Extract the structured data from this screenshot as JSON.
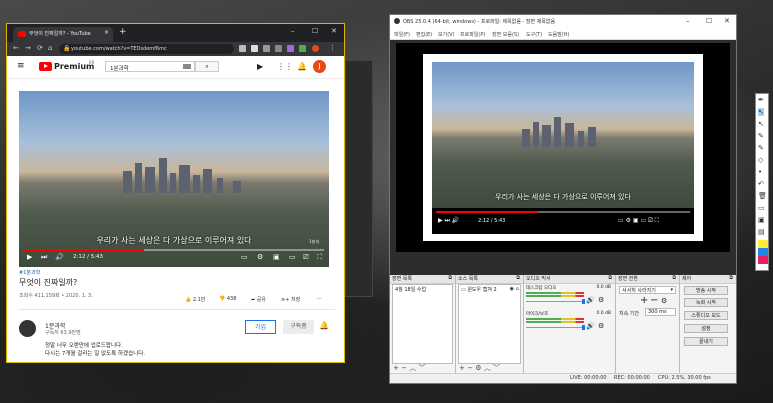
{
  "chrome": {
    "tab_title": "무엇이 진짜일까? - YouTube",
    "url": "youtube.com/watch?v=TEDsdemf6mc",
    "nav": [
      "←",
      "→",
      "⟳",
      "⌂"
    ]
  },
  "youtube": {
    "brand": "Premium",
    "brand_sup": "KR",
    "search_value": "1분과학",
    "avatar_letter": "J",
    "subtitle": "우리가 사는 세상은 다 가상으로 이루어져 있다",
    "time": "2:12 / 5:43",
    "watermark": "1분과",
    "hashtag": "#1분과학",
    "title": "무엇이 진짜일까?",
    "views": "조회수 411,159회 • 2020. 1. 3.",
    "likes": "2.1만",
    "dislikes": "438",
    "share": "공유",
    "save": "저장",
    "more": "⋯",
    "channel": "1분과학",
    "subscribers": "구독자 63.9만명",
    "join": "가입",
    "subscribed": "구독중",
    "desc_line1": "정말 너무 오랜만에 업로드합니다.",
    "desc_line2": "다시는 7개월 걸리는 일 없도록 하겠습니다."
  },
  "obs": {
    "title": "OBS 25.0.4 (64-bit, windows) - 프로파일: 제목없음 - 장면 제목없음",
    "menu": [
      "파일(F)",
      "편집(E)",
      "보기(V)",
      "프로파일(P)",
      "장면 모음(S)",
      "도구(T)",
      "도움말(H)"
    ],
    "preview_subtitle": "우리가 사는 세상은 다 가상으로 이루어져 있다",
    "preview_time": "2:12 / 5:43",
    "docks": {
      "scenes": "장면 목록",
      "sources": "소스 목록",
      "mixer": "오디오 믹서",
      "transitions": "장면 전환",
      "controls": "제어"
    },
    "scene_item": "4월 18일 수업",
    "source_item": "윈도우 캡쳐 2",
    "mixer_rows": [
      {
        "name": "데스크탑 오디오",
        "db": "0.0 dB"
      },
      {
        "name": "마이크/보조",
        "db": "0.0 dB"
      }
    ],
    "transition": "서서히 사라지기",
    "duration_label": "지속 기간",
    "duration_value": "300 ms",
    "controls_buttons": [
      "방송 시작",
      "녹화 시작",
      "스튜디오 모드",
      "설정",
      "끝내기"
    ],
    "status": {
      "live": "LIVE: 00:00:00",
      "rec": "REC: 00:00:00",
      "cpu": "CPU: 2.5%, 30.00 fps"
    }
  }
}
